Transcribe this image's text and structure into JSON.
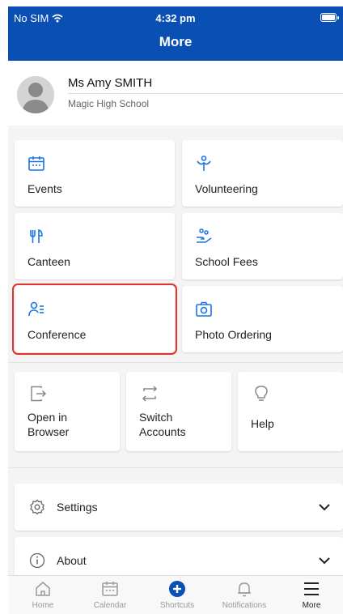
{
  "status_bar": {
    "carrier": "No SIM",
    "time": "4:32 pm"
  },
  "header": {
    "title": "More"
  },
  "profile": {
    "name": "Ms Amy SMITH",
    "school": "Magic High School"
  },
  "tiles": [
    {
      "label": "Events",
      "icon": "calendar-icon"
    },
    {
      "label": "Volunteering",
      "icon": "volunteer-icon"
    },
    {
      "label": "Canteen",
      "icon": "cutlery-icon"
    },
    {
      "label": "School Fees",
      "icon": "hand-coins-icon"
    },
    {
      "label": "Conference",
      "icon": "person-list-icon"
    },
    {
      "label": "Photo Ordering",
      "icon": "camera-icon"
    }
  ],
  "small_tiles": [
    {
      "label": "Open in Browser",
      "icon": "open-external-icon"
    },
    {
      "label": "Switch Accounts",
      "icon": "switch-arrows-icon"
    },
    {
      "label": "Help",
      "icon": "lightbulb-icon"
    }
  ],
  "rows": [
    {
      "label": "Settings",
      "icon": "gear-icon"
    },
    {
      "label": "About",
      "icon": "info-icon"
    }
  ],
  "tabbar": [
    {
      "label": "Home",
      "icon": "home-icon"
    },
    {
      "label": "Calendar",
      "icon": "calendar-icon"
    },
    {
      "label": "Shortcuts",
      "icon": "plus-circle-icon"
    },
    {
      "label": "Notifications",
      "icon": "bell-icon"
    },
    {
      "label": "More",
      "icon": "menu-icon"
    }
  ],
  "colors": {
    "brand": "#0a4fb4",
    "accent": "#1a73e8",
    "highlight": "#e0342a"
  }
}
